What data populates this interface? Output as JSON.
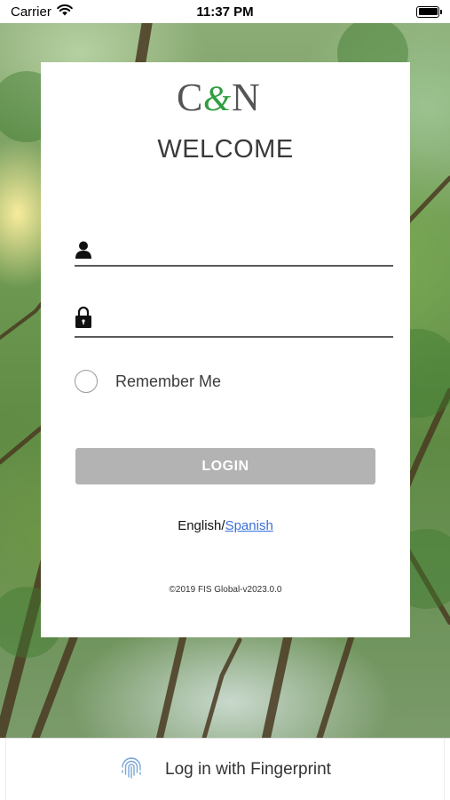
{
  "status_bar": {
    "carrier": "Carrier",
    "time": "11:37 PM"
  },
  "brand": {
    "logo_text_left": "C",
    "logo_text_amp": "&",
    "logo_text_right": "N",
    "logo_amp_color": "#2f9e3f"
  },
  "login_card": {
    "welcome": "WELCOME",
    "username": {
      "value": "",
      "placeholder": "",
      "icon": "user-icon"
    },
    "password": {
      "value": "",
      "placeholder": "",
      "icon": "lock-icon"
    },
    "remember_label": "Remember Me",
    "remember_checked": false,
    "login_button": "LOGIN",
    "language": {
      "current": "English",
      "separator": "/",
      "alternate": "Spanish"
    },
    "copyright": "©2019 FIS Global-v2023.0.0"
  },
  "bottom_bar": {
    "icon": "fingerprint-icon",
    "label": "Log in with Fingerprint"
  }
}
